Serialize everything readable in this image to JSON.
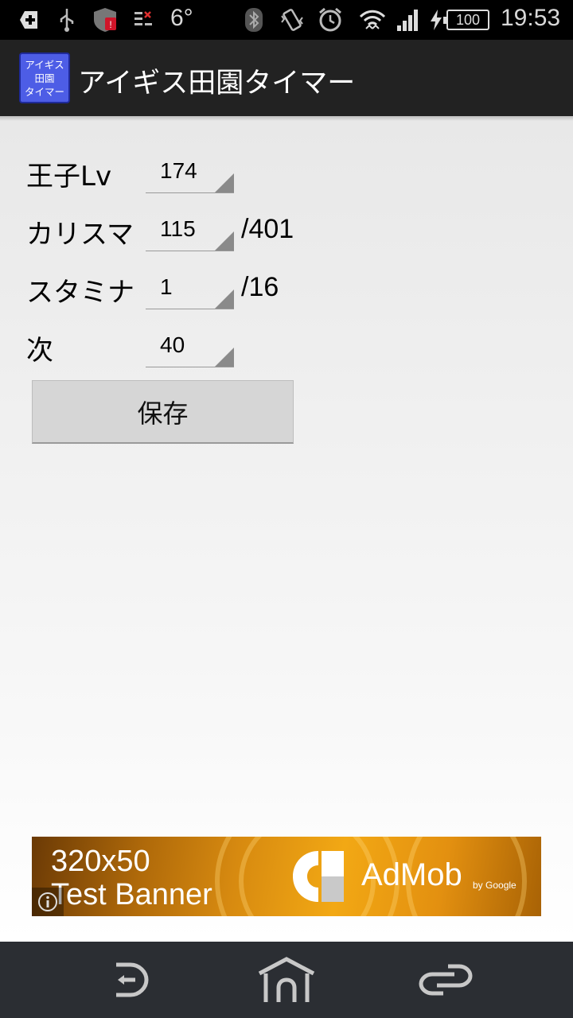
{
  "status_bar": {
    "temperature": "6°",
    "battery": "100",
    "time": "19:53",
    "icons": [
      "plus-icon",
      "usb-icon",
      "shield-alert-icon",
      "data-icon",
      "bluetooth-icon",
      "vibrate-icon",
      "alarm-icon",
      "wifi-icon",
      "signal-icon",
      "charging-icon",
      "battery-icon"
    ]
  },
  "action_bar": {
    "app_icon_lines": [
      "アイギス",
      "田園",
      "タイマー"
    ],
    "title": "アイギス田園タイマー"
  },
  "form": {
    "rows": [
      {
        "label": "王子Lv",
        "value": "174",
        "suffix": ""
      },
      {
        "label": "カリスマ",
        "value": "115",
        "suffix": "/401"
      },
      {
        "label": "スタミナ",
        "value": "1",
        "suffix": "/16"
      },
      {
        "label": "次",
        "value": "40",
        "suffix": ""
      }
    ],
    "save_label": "保存"
  },
  "ad": {
    "line1": "320x50",
    "line2": "Test Banner",
    "brand": "AdMob",
    "by": "by Google",
    "colors": {
      "start": "#6b3a05",
      "mid": "#f2a814"
    }
  },
  "nav_bar": {
    "icons": [
      "back-icon",
      "home-icon",
      "recent-apps-icon"
    ]
  }
}
